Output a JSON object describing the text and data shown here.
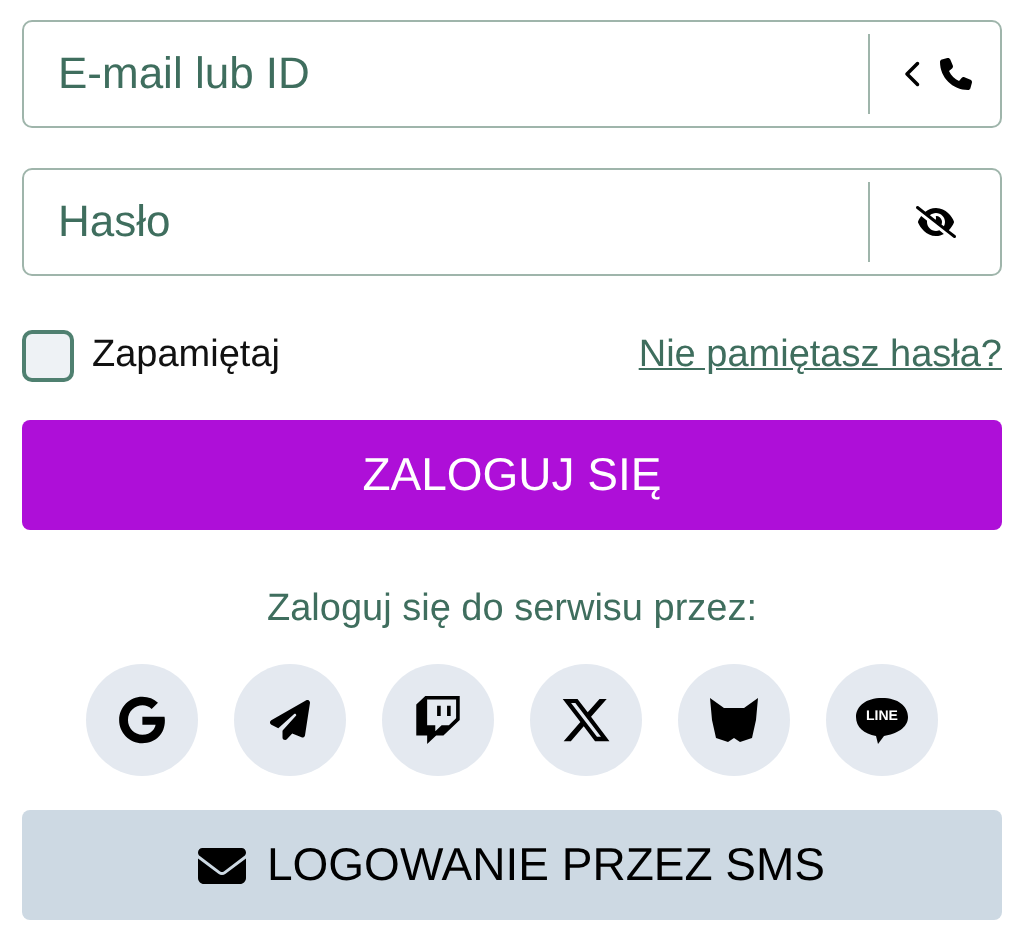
{
  "email_field": {
    "placeholder": "E-mail lub ID"
  },
  "password_field": {
    "placeholder": "Hasło"
  },
  "remember": {
    "label": "Zapamiętaj",
    "checked": false
  },
  "forgot_link": "Nie pamiętasz hasła?",
  "login_button": "ZALOGUJ SIĘ",
  "social_heading": "Zaloguj się do serwisu przez:",
  "social": [
    {
      "kind": "google"
    },
    {
      "kind": "telegram"
    },
    {
      "kind": "twitch"
    },
    {
      "kind": "x"
    },
    {
      "kind": "fox"
    },
    {
      "kind": "line",
      "label": "LINE"
    }
  ],
  "sms_button": "LOGOWANIE PRZEZ SMS"
}
